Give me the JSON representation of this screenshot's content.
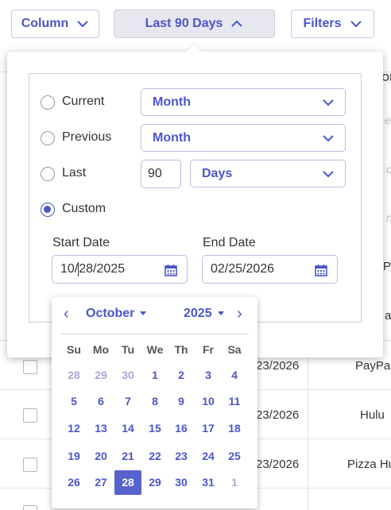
{
  "toolbar": {
    "column_label": "Column",
    "range_label": "Last 90 Days",
    "filters_label": "Filters"
  },
  "background": {
    "header_fragment": "OF",
    "faded": [
      "e /",
      "o",
      "n"
    ],
    "mid_fragments": [
      "P",
      "a"
    ],
    "rows": [
      {
        "date": "23/2026",
        "name": "PayPa"
      },
      {
        "date": "23/2026",
        "name": "Hulu"
      },
      {
        "date": "23/2026",
        "name": "Pizza Hu"
      }
    ]
  },
  "range_picker": {
    "options": [
      {
        "label": "Current",
        "selected": false
      },
      {
        "label": "Previous",
        "selected": false
      },
      {
        "label": "Last",
        "selected": false
      },
      {
        "label": "Custom",
        "selected": true
      }
    ],
    "current_unit": "Month",
    "previous_unit": "Month",
    "last_count": "90",
    "last_unit": "Days",
    "start_label": "Start Date",
    "end_label": "End Date",
    "start_value_before_caret": "10/",
    "start_value_after_caret": "28/2025",
    "end_value": "02/25/2026"
  },
  "calendar": {
    "prev_icon": "‹",
    "next_icon": "›",
    "month": "October",
    "year": "2025",
    "weekdays": [
      "Su",
      "Mo",
      "Tu",
      "We",
      "Th",
      "Fr",
      "Sa"
    ],
    "weeks": [
      [
        "28",
        "29",
        "30",
        "1",
        "2",
        "3",
        "4"
      ],
      [
        "5",
        "6",
        "7",
        "8",
        "9",
        "10",
        "11"
      ],
      [
        "12",
        "13",
        "14",
        "15",
        "16",
        "17",
        "18"
      ],
      [
        "19",
        "20",
        "21",
        "22",
        "23",
        "24",
        "25"
      ],
      [
        "26",
        "27",
        "28",
        "29",
        "30",
        "31",
        "1"
      ]
    ],
    "selected_day": "28"
  },
  "colors": {
    "accent": "#4a56c8",
    "selected_day_bg": "#5763cc",
    "muted_day": "#a6a9d6"
  }
}
